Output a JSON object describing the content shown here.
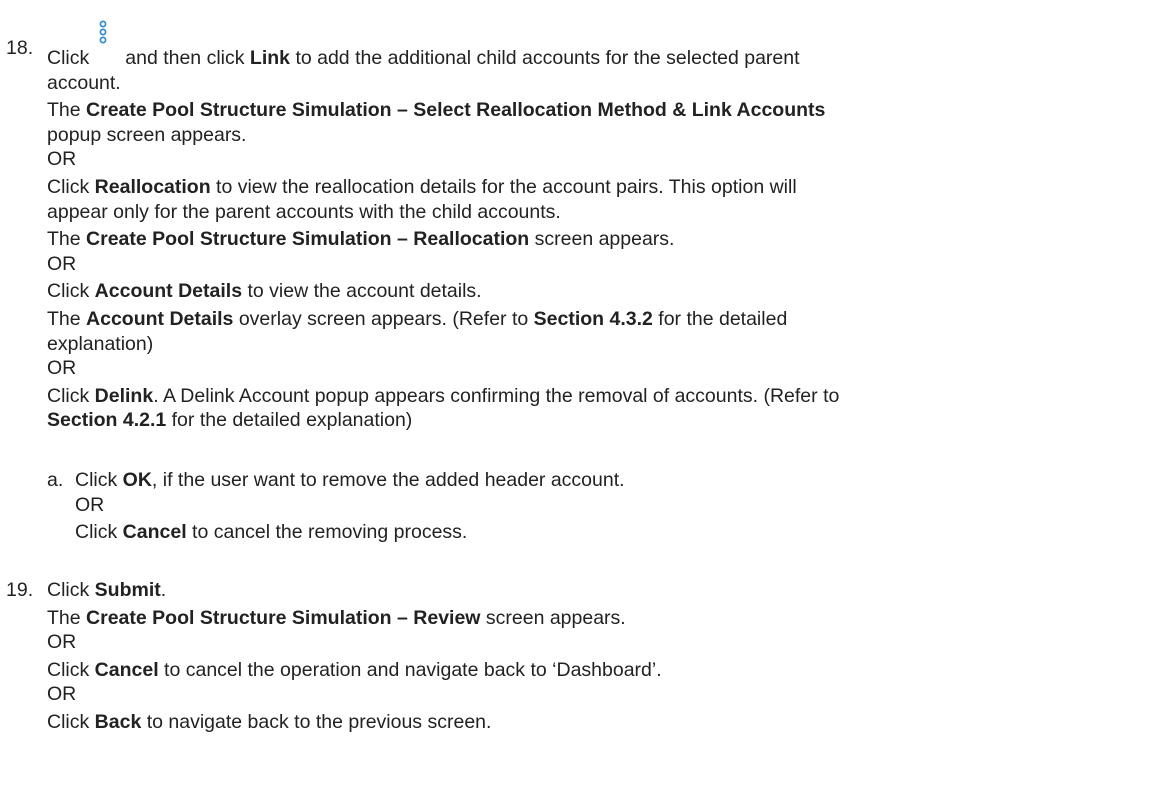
{
  "step18": {
    "number": "18.",
    "line1_a": "Click",
    "icon": "kebab-menu-icon",
    "line1_b": "and then click",
    "line1_c": "Link",
    "line1_d": "to add the additional child accounts for the selected parent",
    "line2": "account.",
    "line3_a": "The",
    "line3_b": "Create Pool Structure Simulation – Select Reallocation Method & Link Accounts",
    "line4": "popup screen appears.",
    "or1": "OR",
    "line6_a": "Click",
    "line6_b": "Reallocation",
    "line6_c": "to view the reallocation details for the account pairs. This option will",
    "line7": "appear only for the parent accounts with the child accounts.",
    "line8_a": "The",
    "line8_b": "Create Pool Structure Simulation – Reallocation",
    "line8_c": "screen appears.",
    "or2": "OR",
    "line10_a": "Click",
    "line10_b": "Account Details",
    "line10_c": "to view the account details.",
    "line11_a": "The",
    "line11_b": "Account Details",
    "line11_c": "overlay screen appears. (Refer to",
    "line11_d": "Section 4.3.2",
    "line11_e": "for the detailed",
    "line12": "explanation)",
    "or3": "OR",
    "line14_a": "Click",
    "line14_b": "Delink",
    "line14_c": ". A Delink Account popup appears confirming the removal of accounts. (Refer to",
    "line15_a": "Section 4.2.1",
    "line15_b": "for the detailed explanation)",
    "sub_a": {
      "letter": "a.",
      "line1_a": "Click",
      "line1_b": "OK",
      "line1_c": ", if the user want to remove the added header account.",
      "or": "OR",
      "line3_a": "Click",
      "line3_b": "Cancel",
      "line3_c": "to cancel the removing process."
    }
  },
  "step19": {
    "number": "19.",
    "line1_a": "Click",
    "line1_b": "Submit",
    "line1_c": ".",
    "line2_a": "The",
    "line2_b": "Create Pool Structure Simulation – Review",
    "line2_c": "screen appears.",
    "or1": "OR",
    "line4_a": "Click",
    "line4_b": "Cancel",
    "line4_c": "to cancel the operation and navigate back to ‘Dashboard’.",
    "or2": "OR",
    "line6_a": "Click",
    "line6_b": "Back",
    "line6_c": "to navigate back to the previous screen."
  },
  "colors": {
    "text": "#222222",
    "icon": "#2b8fd6"
  }
}
